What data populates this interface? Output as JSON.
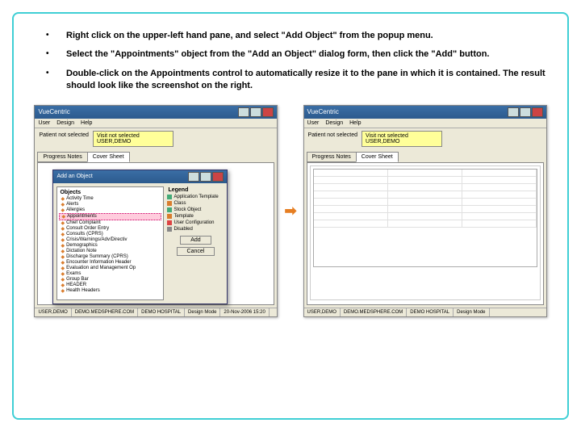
{
  "instructions": {
    "item1": "Right click on the upper-left hand pane, and select \"Add Object\" from the popup menu.",
    "item2": "Select the \"Appointments\" object from the \"Add an Object\" dialog form, then click the \"Add\" button.",
    "item3": "Double-click on the Appointments control to automatically resize it to the pane in which it is contained. The result should look like the screenshot on the right."
  },
  "leftApp": {
    "title": "VueCentric",
    "menu": {
      "user": "User",
      "design": "Design",
      "help": "Help"
    },
    "patientLabel": "Patient not selected",
    "visitInfo": {
      "line1": "Visit not selected",
      "line2": "USER,DEMO"
    },
    "tabs": {
      "progress": "Progress Notes",
      "cover": "Cover Sheet"
    },
    "status": {
      "s1": "USER,DEMO",
      "s2": "DEMO.MEDSPHERE.COM",
      "s3": "DEMO HOSPITAL",
      "s4": "Design Mode",
      "s5": "20-Nov-2006 15:20"
    }
  },
  "dialog": {
    "title": "Add an Object",
    "objectsTitle": "Objects",
    "legendTitle": "Legend",
    "items": {
      "i1": "Activity Time",
      "i2": "Alerts",
      "i3": "Allergies",
      "i4": "Appointments",
      "i5": "Chief Complaint",
      "i6": "Consult Order Entry",
      "i7": "Consults (CPRS)",
      "i8": "Crisis/Warnings/Adv/Directiv",
      "i9": "Demographics",
      "i10": "Dictation Note",
      "i11": "Discharge Summary (CPRS)",
      "i12": "Encounter Information Header",
      "i13": "Evaluation and Management Op",
      "i14": "Exams",
      "i15": "Group Bar",
      "i16": "HEADER",
      "i17": "Health Headers"
    },
    "legend": {
      "l1": "Application Template",
      "l2": "Class",
      "l3": "Stock Object",
      "l4": "Template",
      "l5": "User Configuration",
      "l6": "Disabled"
    },
    "buttons": {
      "add": "Add",
      "cancel": "Cancel"
    }
  },
  "rightApp": {
    "title": "VueCentric",
    "menu": {
      "user": "User",
      "design": "Design",
      "help": "Help"
    },
    "patientLabel": "Patient not selected",
    "visitInfo": {
      "line1": "Visit not selected",
      "line2": "USER,DEMO"
    },
    "tabs": {
      "progress": "Progress Notes",
      "cover": "Cover Sheet"
    },
    "status": {
      "s1": "USER,DEMO",
      "s2": "DEMO.MEDSPHERE.COM",
      "s3": "DEMO HOSPITAL",
      "s4": "Design Mode"
    }
  },
  "arrow": "➡"
}
